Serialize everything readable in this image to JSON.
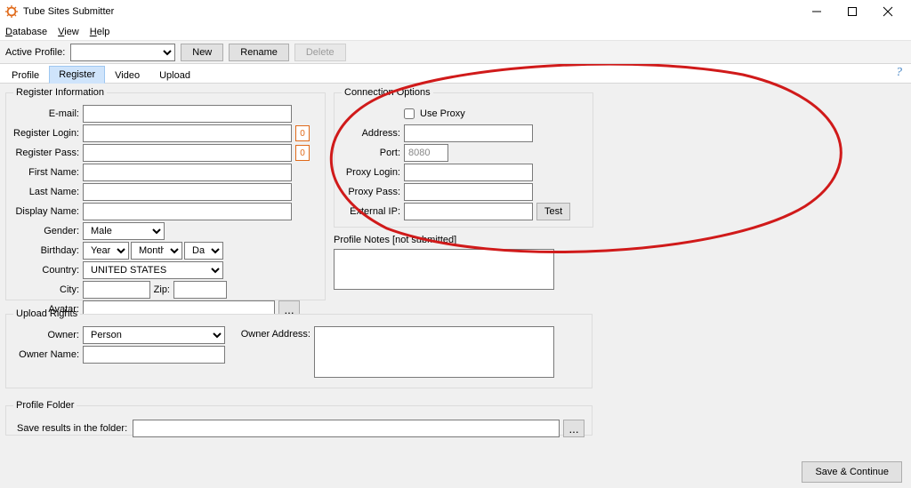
{
  "window": {
    "title": "Tube Sites Submitter"
  },
  "menu": {
    "database": "Database",
    "view": "View",
    "help": "Help"
  },
  "toolbar": {
    "active_profile_label": "Active Profile:",
    "active_profile_value": "",
    "new_label": "New",
    "rename_label": "Rename",
    "delete_label": "Delete"
  },
  "tabs": {
    "list": [
      "Profile",
      "Register",
      "Video",
      "Upload"
    ],
    "active": "Register"
  },
  "register": {
    "legend": "Register Information",
    "email_label": "E-mail:",
    "email_value": "",
    "login_label": "Register Login:",
    "login_value": "",
    "login_count": "0",
    "pass_label": "Register Pass:",
    "pass_value": "",
    "pass_count": "0",
    "firstname_label": "First Name:",
    "firstname_value": "",
    "lastname_label": "Last Name:",
    "lastname_value": "",
    "displayname_label": "Display Name:",
    "displayname_value": "",
    "gender_label": "Gender:",
    "gender_value": "Male",
    "birthday_label": "Birthday:",
    "birthday_year": "Year",
    "birthday_month": "Month",
    "birthday_day": "Day",
    "country_label": "Country:",
    "country_value": "UNITED STATES",
    "city_label": "City:",
    "city_value": "",
    "zip_label": "Zip:",
    "zip_value": "",
    "avatar_label": "Avatar:",
    "avatar_value": "",
    "browse_label": "..."
  },
  "connection": {
    "legend": "Connection Options",
    "use_proxy_label": "Use Proxy",
    "use_proxy_checked": false,
    "address_label": "Address:",
    "address_value": "",
    "port_label": "Port:",
    "port_value": "8080",
    "login_label": "Proxy Login:",
    "login_value": "",
    "pass_label": "Proxy Pass:",
    "pass_value": "",
    "externalip_label": "External IP:",
    "externalip_value": "",
    "test_label": "Test"
  },
  "notes": {
    "legend": "Profile Notes [not submitted]",
    "value": ""
  },
  "upload": {
    "legend": "Upload Rights",
    "owner_label": "Owner:",
    "owner_value": "Person",
    "owner_name_label": "Owner Name:",
    "owner_name_value": "",
    "owner_address_label": "Owner Address:",
    "owner_address_value": ""
  },
  "folder": {
    "legend": "Profile Folder",
    "save_label": "Save results in the folder:",
    "value": "",
    "browse_label": "..."
  },
  "bottom": {
    "save_continue": "Save & Continue"
  }
}
